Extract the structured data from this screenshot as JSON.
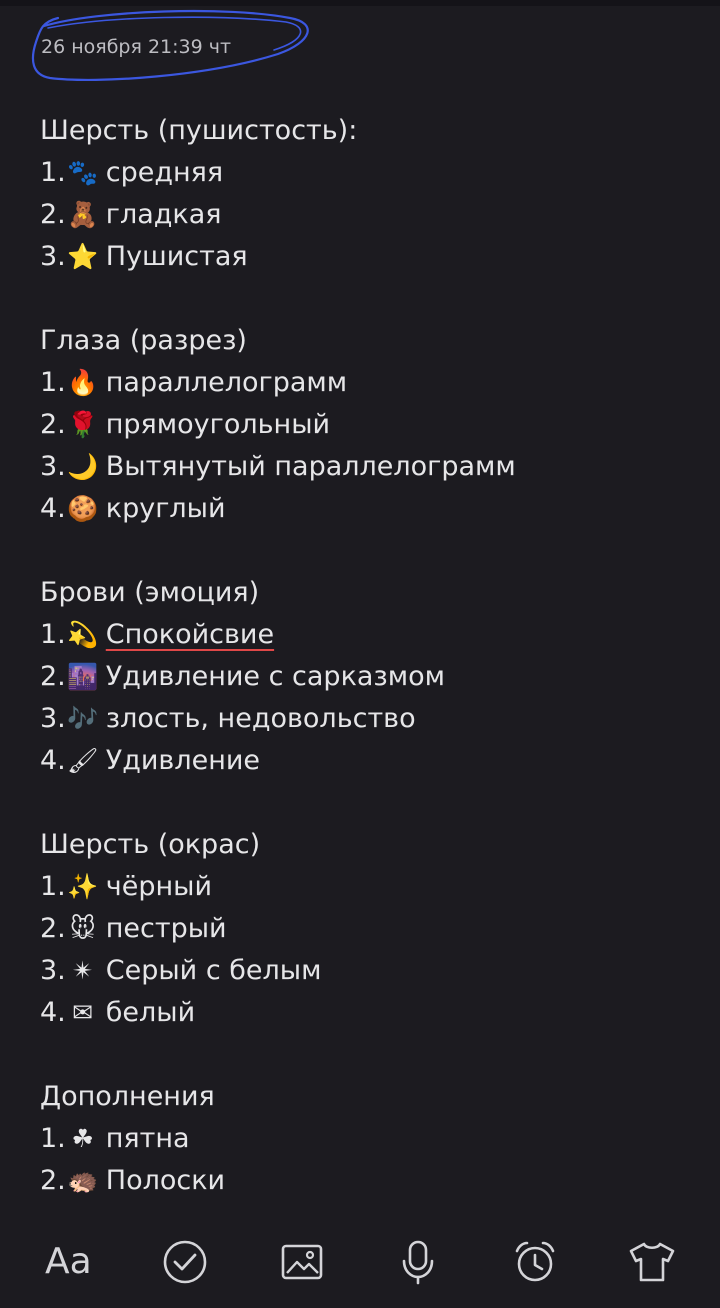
{
  "note": {
    "date": "26 ноября 21:39 чт",
    "sections": [
      {
        "heading": "Шерсть (пушистость):",
        "items": [
          {
            "num": "1.",
            "emoji": "🐾",
            "text": "средняя"
          },
          {
            "num": "2.",
            "emoji": "🧸",
            "text": "гладкая"
          },
          {
            "num": "3.",
            "emoji": "⭐",
            "text": "Пушистая"
          }
        ]
      },
      {
        "heading": "Глаза (разрез)",
        "items": [
          {
            "num": "1. ",
            "emoji": "🔥",
            "text": "параллелограмм"
          },
          {
            "num": "2.",
            "emoji": "🌹",
            "text": "прямоугольный"
          },
          {
            "num": "3.",
            "emoji": "🌙",
            "text": "Вытянутый параллелограмм"
          },
          {
            "num": "4.",
            "emoji": "🍪",
            "text": "круглый"
          }
        ]
      },
      {
        "heading": "Брови (эмоция)",
        "items": [
          {
            "num": "1.",
            "emoji": "💫",
            "text": "Спокойсвие",
            "misspelled": true
          },
          {
            "num": "2.",
            "emoji": "🌆",
            "text": "Удивление с сарказмом"
          },
          {
            "num": "3.",
            "emoji": "🎶",
            "text": "злость, недовольство"
          },
          {
            "num": "4.",
            "emoji": "🖌",
            "text": "Удивление"
          }
        ]
      },
      {
        "heading": "Шерсть (окрас)",
        "items": [
          {
            "num": "1.",
            "emoji": "✨",
            "text": "чёрный"
          },
          {
            "num": "2.",
            "emoji": "🐭",
            "text": "пестрый"
          },
          {
            "num": "3.",
            "emoji": "✴",
            "text": "Серый с белым"
          },
          {
            "num": "4.",
            "emoji": "✉",
            "text": "белый"
          }
        ]
      },
      {
        "heading": "Дополнения",
        "items": [
          {
            "num": "1. ",
            "emoji": "☘",
            "text": "пятна"
          },
          {
            "num": "2.",
            "emoji": "🦔",
            "text": "Полоски"
          }
        ]
      }
    ]
  },
  "toolbar": {
    "text_format_label": "Aa",
    "icons": [
      "text-format",
      "checklist-icon",
      "image-icon",
      "microphone-icon",
      "alarm-clock-icon",
      "shirt-icon"
    ]
  },
  "colors": {
    "background": "#1c1b20",
    "text": "#e6e6e8",
    "date_text": "#bdbdc2",
    "scribble": "#3b57e0",
    "spell_underline": "#e04848"
  }
}
